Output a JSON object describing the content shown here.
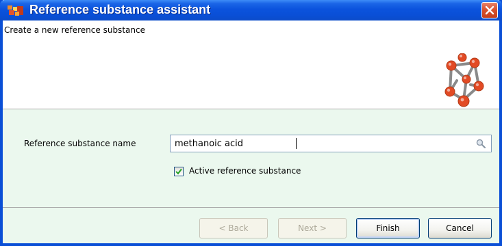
{
  "window": {
    "title": "Reference substance assistant",
    "app_icon": "app-logo-icon",
    "close_icon": "close-icon"
  },
  "header": {
    "message": "Create a new reference substance",
    "icon": "molecule-lattice-icon"
  },
  "form": {
    "name_label": "Reference substance name",
    "name_value": "methanoic acid",
    "search_icon": "search-icon",
    "active_checkbox": {
      "label": "Active reference substance",
      "checked": true
    }
  },
  "buttons": {
    "back_label": "< Back",
    "next_label": "Next >",
    "finish_label": "Finish",
    "cancel_label": "Cancel"
  },
  "colors": {
    "title_bar": "#0a4fd6",
    "content_bg": "#ebf8ee",
    "close_button": "#d9532f",
    "checkmark": "#21a121"
  }
}
